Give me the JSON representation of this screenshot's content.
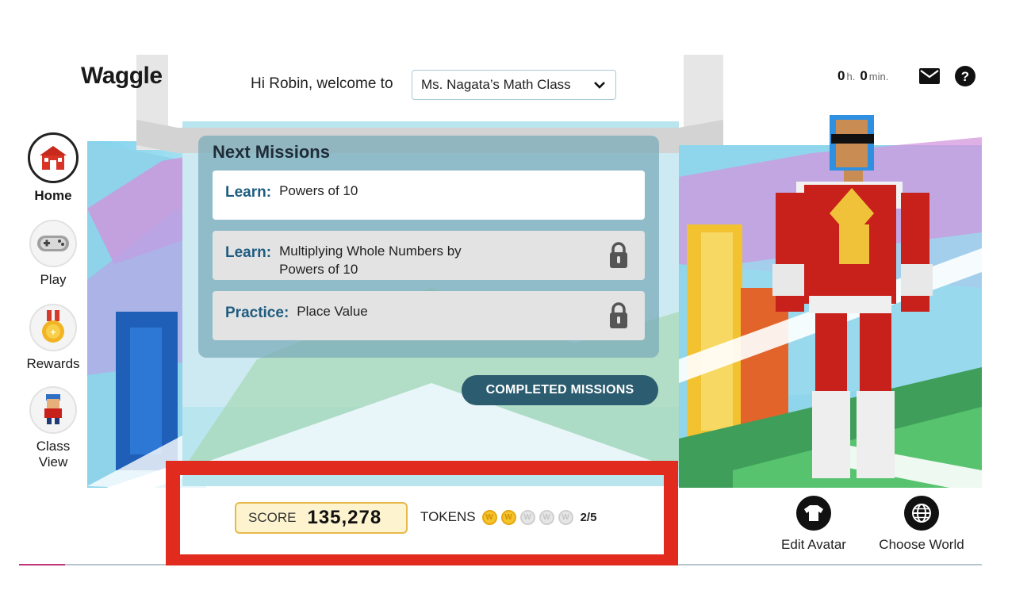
{
  "app": {
    "logo": "Waggle"
  },
  "header": {
    "greeting": "Hi Robin, welcome to",
    "class_select": {
      "value": "Ms. Nagata’s Math Class"
    },
    "timer": {
      "hours": "0",
      "hours_unit": "h.",
      "minutes": "0",
      "minutes_unit": "min."
    },
    "icons": [
      "mail-icon",
      "help-icon"
    ]
  },
  "sidebar": {
    "items": [
      {
        "label": "Home",
        "icon": "home-icon",
        "active": true
      },
      {
        "label": "Play",
        "icon": "gamepad-icon",
        "active": false
      },
      {
        "label": "Rewards",
        "icon": "medal-icon",
        "active": false
      },
      {
        "label": "Class View",
        "label_line1": "Class",
        "label_line2": "View",
        "icon": "classmate-avatar-icon",
        "active": false
      }
    ]
  },
  "missions": {
    "heading": "Next Missions",
    "items": [
      {
        "kind": "Learn:",
        "title": "Powers of 10",
        "title_line1": "Powers of 10",
        "title_line2": "",
        "locked": false
      },
      {
        "kind": "Learn:",
        "title": "Multiplying Whole Numbers by Powers of 10",
        "title_line1": "Multiplying Whole Numbers by",
        "title_line2": "Powers of 10",
        "locked": true
      },
      {
        "kind": "Practice:",
        "title": "Place Value",
        "title_line1": "Place Value",
        "title_line2": "",
        "locked": true
      }
    ],
    "completed_button": "COMPLETED MISSIONS"
  },
  "footer": {
    "score_label": "SCORE",
    "score_value": "135,278",
    "tokens_label": "TOKENS",
    "tokens_earned": 2,
    "tokens_total": 5,
    "tokens_count": "2/5",
    "coin_letter": "W",
    "actions": [
      {
        "label": "Edit Avatar",
        "icon": "shirt-icon"
      },
      {
        "label": "Choose World",
        "icon": "globe-icon"
      }
    ]
  },
  "colors": {
    "highlight_box": "#e22b1f",
    "mission_kind": "#1f5c80",
    "completed_button": "#2b5c6f",
    "score_box": "#fdf3cf",
    "token_gold": "#f4c52a"
  }
}
